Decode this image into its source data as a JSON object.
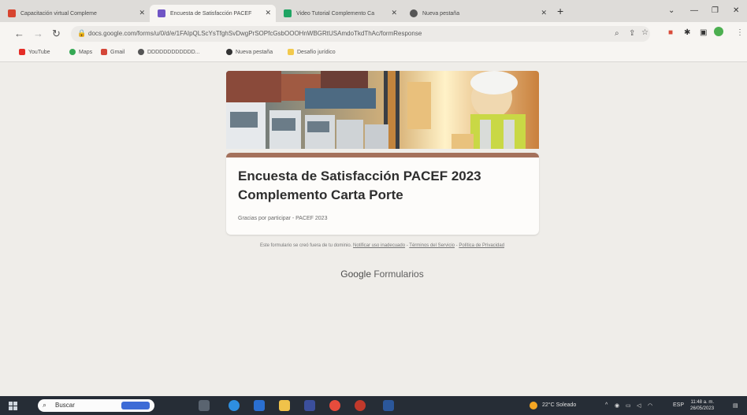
{
  "tabs": [
    {
      "label": "Capacitación virtual Compleme",
      "icon_color": "#d7442f",
      "active": false
    },
    {
      "label": "Encuesta de Satisfacción PACEF",
      "icon_color": "#7055c5",
      "active": true
    },
    {
      "label": "Video Tutorial Complemento Ca",
      "icon_color": "#1fa463",
      "active": false
    },
    {
      "label": "Nueva pestaña",
      "icon_color": "#555555",
      "active": false
    }
  ],
  "address": {
    "url": "docs.google.com/forms/u/0/d/e/1FAIpQLScYsTfghSvDwgPrSOPfcGsbOOOHnWBGRtUSAmdoTkdThAc/formResponse"
  },
  "bookmarks": [
    {
      "label": "YouTube",
      "icon_color": "#e52d27"
    },
    {
      "label": "Maps",
      "icon_color": "#34a853"
    },
    {
      "label": "Gmail",
      "icon_color": "#d44638"
    },
    {
      "label": "DDDDDDDDDDDD...",
      "icon_color": "#555555"
    },
    {
      "label": "Nueva pestaña",
      "icon_color": "#333333"
    },
    {
      "label": "Desafío jurídico",
      "icon_color": "#f2c94c"
    }
  ],
  "form": {
    "title": "Encuesta de Satisfacción PACEF 2023 Complemento Carta Porte",
    "subtitle": "Gracias por participar - PACEF 2023",
    "accent_color": "#a4715c"
  },
  "footer": {
    "text": "Este formulario se creó fuera de tu dominio.",
    "report_link": "Notificar uso inadecuado",
    "terms_link": "Términos del Servicio",
    "privacy_link": "Política de Privacidad",
    "brand_google": "Google",
    "brand_forms": "Formularios"
  },
  "taskbar": {
    "search_placeholder": "Buscar",
    "weather": "22°C Soleado",
    "lang": "ESP",
    "time": "11:48 a. m.",
    "date": "26/05/2023"
  }
}
